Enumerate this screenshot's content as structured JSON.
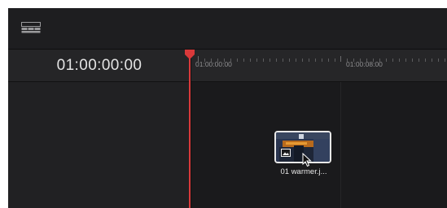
{
  "toolbar": {
    "layout_icon": "timeline-layout-icon"
  },
  "timeline": {
    "timecode": "01:00:00:00",
    "ruler_labels": [
      "01:00:00:00",
      "01:00:08:00"
    ]
  },
  "clip": {
    "label": "01 warmer.j...",
    "icon": "image-icon"
  },
  "cursor": {
    "icon": "mouse-pointer-icon"
  },
  "colors": {
    "background": "#1b1b1d",
    "playhead": "#d9393a",
    "text": "#e3e3e3"
  }
}
